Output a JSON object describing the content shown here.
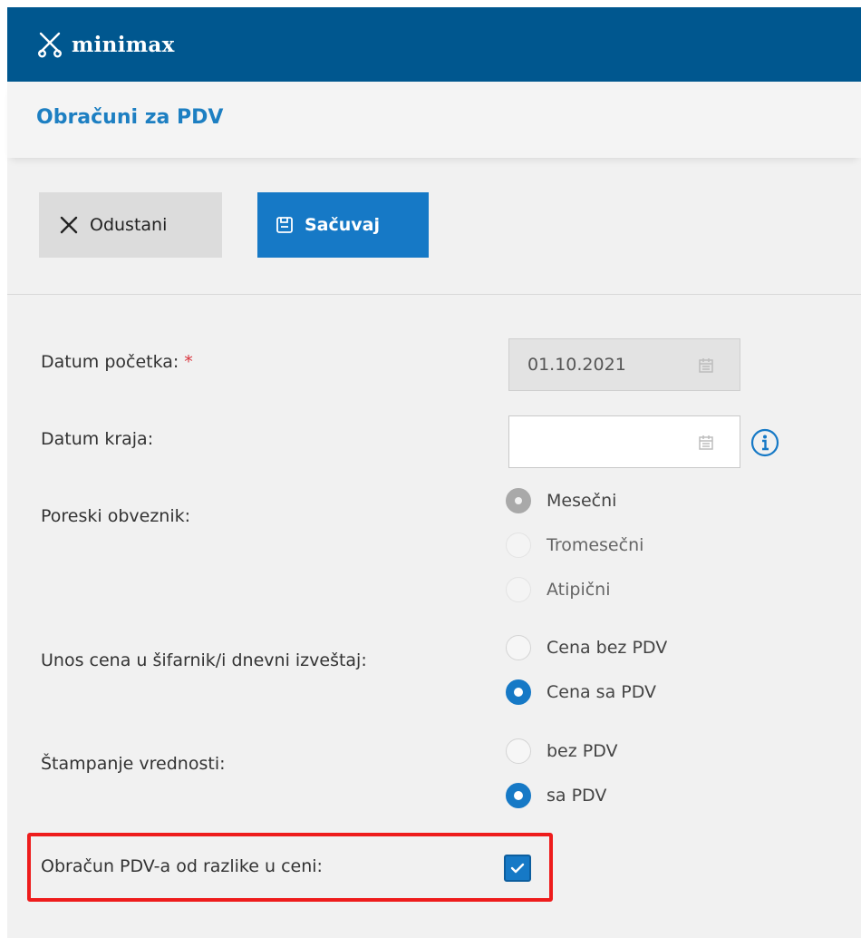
{
  "brand": {
    "name": "minimax",
    "icon": "scissors-x-logo-icon"
  },
  "page": {
    "title": "Obračuni za PDV"
  },
  "toolbar": {
    "cancel_label": "Odustani",
    "save_label": "Sačuvaj"
  },
  "form": {
    "start_date": {
      "label": "Datum početka:",
      "required_mark": "*",
      "value": "01.10.2021"
    },
    "end_date": {
      "label": "Datum kraja:",
      "value": ""
    },
    "taxpayer": {
      "label": "Poreski obveznik:",
      "options": [
        "Mesečni",
        "Tromesečni",
        "Atipični"
      ],
      "selected": "Mesečni"
    },
    "price_entry": {
      "label": "Unos cena u šifarnik/i dnevni izveštaj:",
      "options": [
        "Cena bez PDV",
        "Cena sa PDV"
      ],
      "selected": "Cena sa PDV"
    },
    "printing": {
      "label": "Štampanje vrednosti:",
      "options": [
        "bez PDV",
        "sa PDV"
      ],
      "selected": "sa PDV"
    },
    "margin_vat": {
      "label": "Obračun PDV-a od razlike u ceni:",
      "checked": true
    }
  },
  "colors": {
    "header": "#00578f",
    "accent": "#1679c6",
    "title": "#1d7fc2",
    "highlight": "#ee1c1c",
    "required": "#d9363e"
  }
}
